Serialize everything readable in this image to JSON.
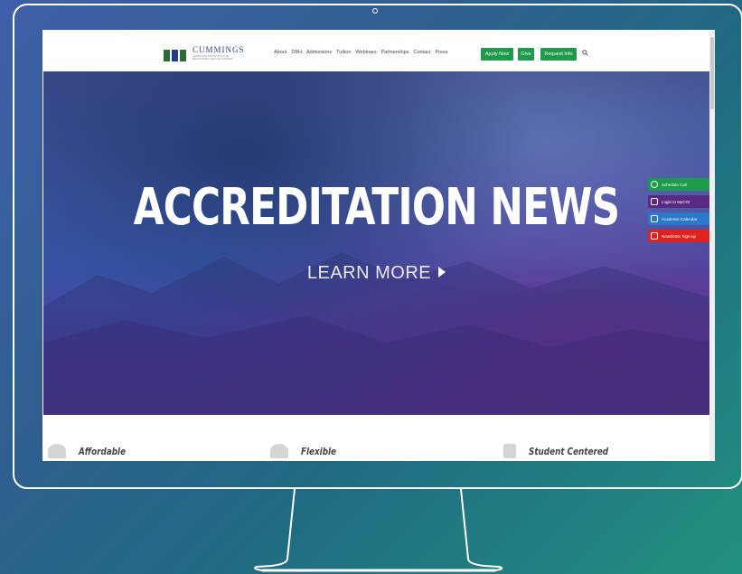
{
  "site": {
    "logo_name": "CUMMINGS",
    "logo_sub": "GRADUATE INSTITUTE FOR BEHAVIORAL HEALTH STUDIES"
  },
  "nav": {
    "items": [
      "About",
      "DBH",
      "Admissions",
      "Tuition",
      "Webinars",
      "Partnerships",
      "Contact",
      "Press"
    ],
    "apply_label": "Apply Now",
    "give_label": "Give",
    "request_label": "Request Info"
  },
  "hero": {
    "title": "ACCREDITATION NEWS",
    "cta": "LEARN MORE"
  },
  "side_tabs": [
    {
      "label": "Schedule Call",
      "color": "#1e9a4b"
    },
    {
      "label": "Login to MyCGI",
      "color": "#5a2a82"
    },
    {
      "label": "Academic Calendar",
      "color": "#2a78c8"
    },
    {
      "label": "Newsletter Sign-up",
      "color": "#e0221f"
    }
  ],
  "features": [
    "Affordable",
    "Flexible",
    "Student Centered"
  ],
  "colors": {
    "accent_green": "#1e9a4b",
    "brand_blue": "#2b3f86"
  }
}
